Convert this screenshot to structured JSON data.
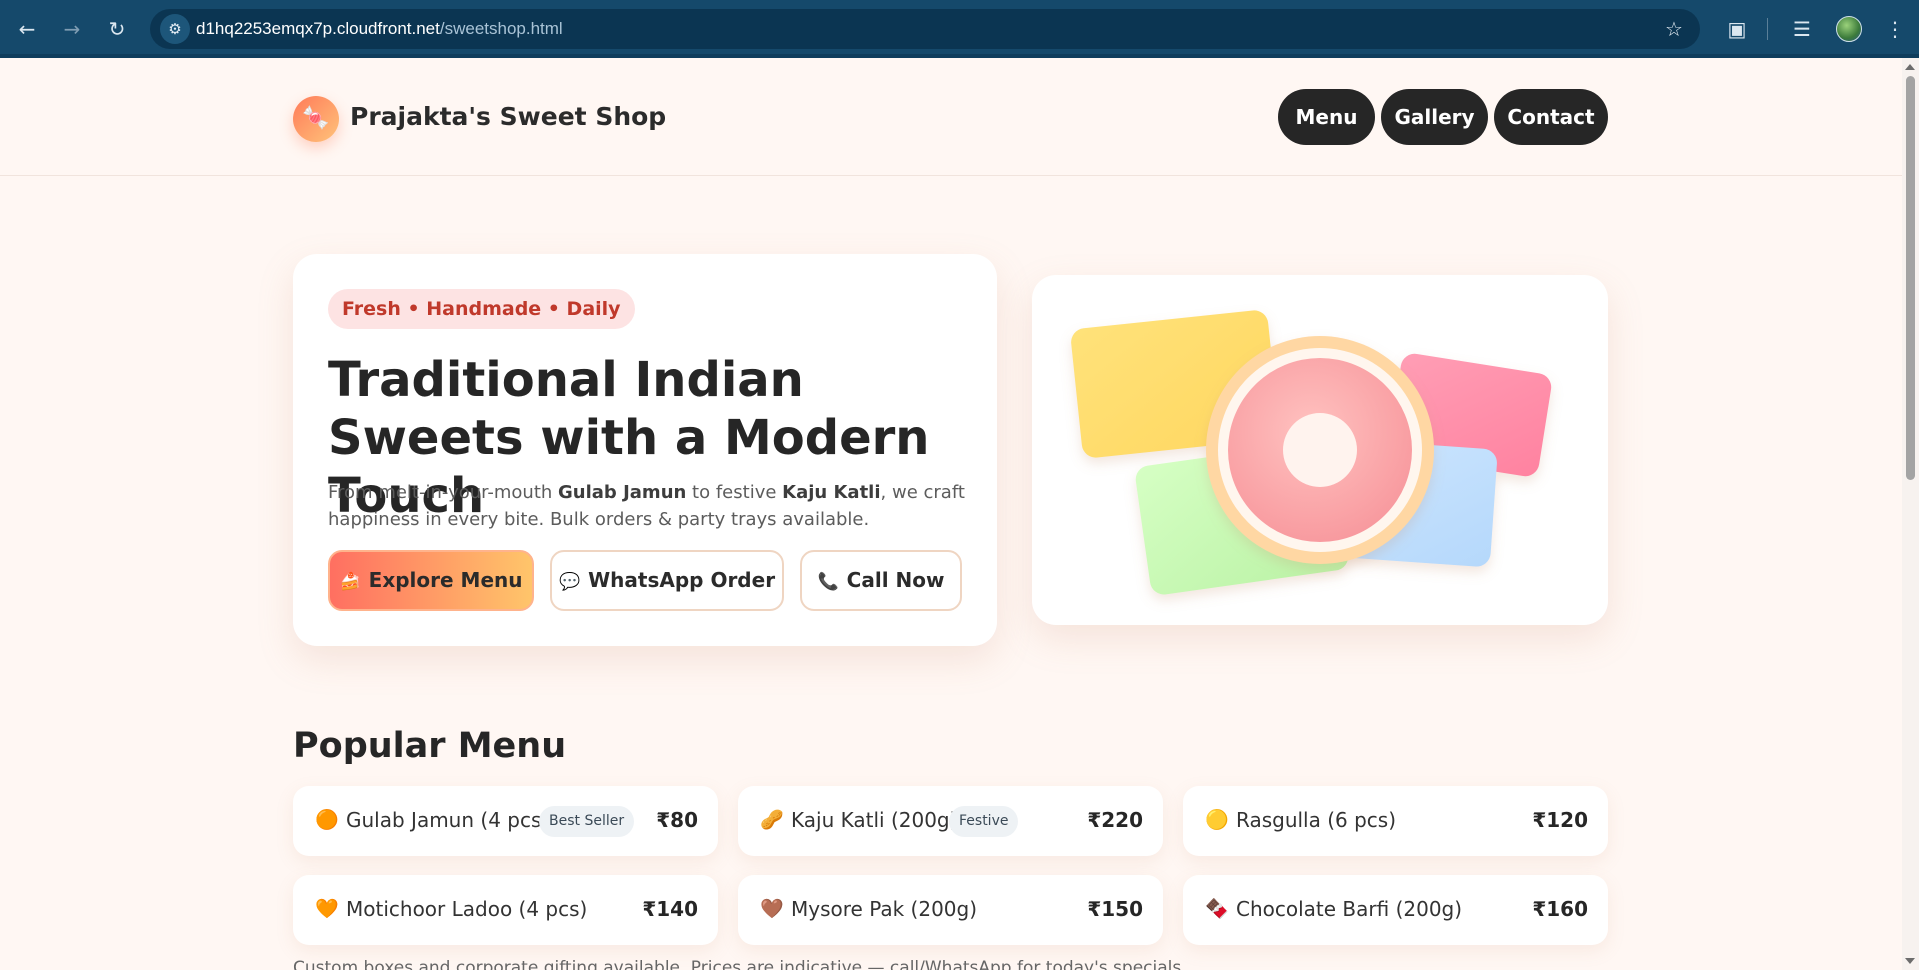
{
  "browser": {
    "url_host": "d1hq2253emqx7p.cloudfront.net",
    "url_path": "/sweetshop.html"
  },
  "header": {
    "logo_icon": "🍬",
    "brand": "Prajakta's Sweet Shop",
    "nav": [
      "Menu",
      "Gallery",
      "Contact"
    ]
  },
  "hero": {
    "pill": "Fresh • Handmade • Daily",
    "title": "Traditional Indian Sweets with a Modern Touch",
    "desc": {
      "p1": "From melt-in-your-mouth ",
      "b1": "Gulab Jamun",
      "p2": " to festive ",
      "b2": "Kaju Katli",
      "p3": ", we craft happiness in every bite. Bulk orders & party trays available."
    },
    "buttons": {
      "explore": {
        "icon": "🍰",
        "label": "Explore Menu"
      },
      "whatsapp": {
        "icon": "💬",
        "label": "WhatsApp Order"
      },
      "call": {
        "icon": "📞",
        "label": "Call Now"
      }
    }
  },
  "menu": {
    "title": "Popular Menu",
    "items": [
      {
        "icon": "🟠",
        "name": "Gulab Jamun (4 pcs)",
        "badge": "Best Seller",
        "price": "₹80"
      },
      {
        "icon": "🥜",
        "name": "Kaju Katli (200g)",
        "badge": "Festive",
        "price": "₹220"
      },
      {
        "icon": "🟡",
        "name": "Rasgulla (6 pcs)",
        "badge": "",
        "price": "₹120"
      },
      {
        "icon": "🧡",
        "name": "Motichoor Ladoo (4 pcs)",
        "badge": "",
        "price": "₹140"
      },
      {
        "icon": "🤎",
        "name": "Mysore Pak (200g)",
        "badge": "",
        "price": "₹150"
      },
      {
        "icon": "🍫",
        "name": "Chocolate Barfi (200g)",
        "badge": "",
        "price": "₹160"
      }
    ],
    "footnote": "Custom boxes and corporate gifting available. Prices are indicative — call/WhatsApp for today's specials."
  },
  "colors": {
    "accent_start": "#ff6f61",
    "accent_end": "#ffc56a",
    "nav_bg": "#262626",
    "page_bg": "#fff7f3",
    "badge_text": "#c0392b"
  }
}
